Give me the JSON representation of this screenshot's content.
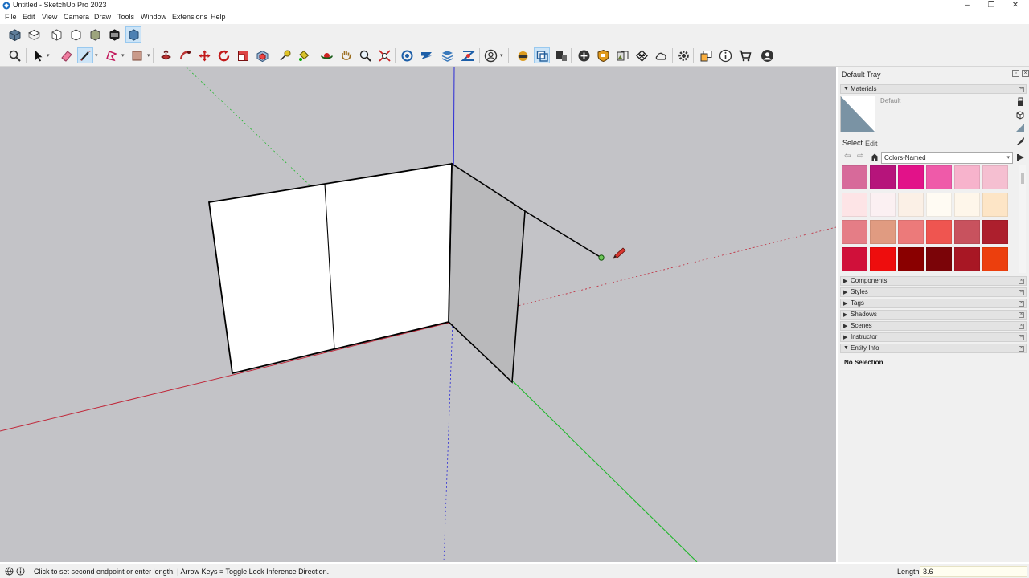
{
  "window": {
    "title": "Untitled - SketchUp Pro 2023",
    "minimize": "–",
    "restore": "❐",
    "close": "✕"
  },
  "menu": [
    "File",
    "Edit",
    "View",
    "Camera",
    "Draw",
    "Tools",
    "Window",
    "Extensions",
    "Help"
  ],
  "viewport": {
    "background": "#c3c3c7",
    "face_color": "#ffffff",
    "back_face_color": "#b9b9bb",
    "edge_color": "#000000",
    "axis_red": "#c0283a",
    "axis_green": "#1fb72b",
    "axis_blue": "#2b2bd6"
  },
  "tray": {
    "title": "Default Tray",
    "materials": {
      "header": "Materials",
      "current_material": "Default",
      "tabs": [
        "Select",
        "Edit"
      ],
      "library": "Colors-Named",
      "swatches": [
        "#d76a9a",
        "#b6147b",
        "#e21289",
        "#ef5aa9",
        "#f7b3cc",
        "#f5bfd1",
        "#fde4e6",
        "#fbf0f2",
        "#fbf0e6",
        "#fffbf3",
        "#fef6ea",
        "#fde5c6",
        "#e57d86",
        "#e09b81",
        "#ec7a7a",
        "#ef5550",
        "#c8525e",
        "#ad1f2d",
        "#d0103a",
        "#ee0d0d",
        "#8a0000",
        "#7b0408",
        "#a81724",
        "#ec3f0d"
      ]
    },
    "panels": [
      "Components",
      "Styles",
      "Tags",
      "Shadows",
      "Scenes",
      "Instructor",
      "Entity Info"
    ],
    "entity_info": {
      "selection": "No Selection"
    }
  },
  "status": {
    "message": "Click to set second endpoint or enter length. | Arrow Keys = Toggle Lock Inference Direction.",
    "measurement_label": "Length",
    "measurement_value": "3.6"
  }
}
